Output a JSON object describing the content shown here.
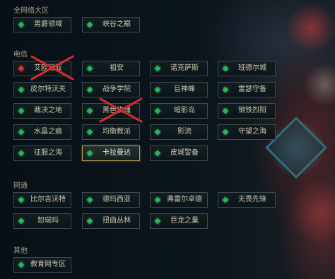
{
  "sections": {
    "all_network": {
      "label": "全网络大区",
      "servers": [
        {
          "name": "男爵领域",
          "status": "green",
          "selected": false
        },
        {
          "name": "峡谷之巅",
          "status": "green",
          "selected": false
        }
      ]
    },
    "telecom": {
      "label": "电信",
      "servers": [
        {
          "name": "艾欧尼亚",
          "status": "red",
          "selected": false
        },
        {
          "name": "祖安",
          "status": "green",
          "selected": false
        },
        {
          "name": "诺克萨斯",
          "status": "green",
          "selected": false
        },
        {
          "name": "班德尔城",
          "status": "green",
          "selected": false
        },
        {
          "name": "皮尔特沃夫",
          "status": "green",
          "selected": false
        },
        {
          "name": "战争学院",
          "status": "green",
          "selected": false
        },
        {
          "name": "巨神峰",
          "status": "green",
          "selected": false
        },
        {
          "name": "雷瑟守备",
          "status": "green",
          "selected": false
        },
        {
          "name": "裁决之地",
          "status": "green",
          "selected": false
        },
        {
          "name": "黑色玫瑰",
          "status": "green",
          "selected": false
        },
        {
          "name": "暗影岛",
          "status": "green",
          "selected": false
        },
        {
          "name": "钢铁烈阳",
          "status": "green",
          "selected": false
        },
        {
          "name": "水晶之痕",
          "status": "green",
          "selected": false
        },
        {
          "name": "均衡教派",
          "status": "green",
          "selected": false
        },
        {
          "name": "影流",
          "status": "green",
          "selected": false
        },
        {
          "name": "守望之海",
          "status": "green",
          "selected": false
        },
        {
          "name": "征服之海",
          "status": "green",
          "selected": false
        },
        {
          "name": "卡拉曼达",
          "status": "green",
          "selected": true
        },
        {
          "name": "皮城警备",
          "status": "green",
          "selected": false
        }
      ]
    },
    "netcom": {
      "label": "网通",
      "servers": [
        {
          "name": "比尔吉沃特",
          "status": "green",
          "selected": false
        },
        {
          "name": "德玛西亚",
          "status": "green",
          "selected": false
        },
        {
          "name": "弗雷尔卓德",
          "status": "green",
          "selected": false
        },
        {
          "name": "无畏先锋",
          "status": "green",
          "selected": false
        },
        {
          "name": "恕瑞玛",
          "status": "green",
          "selected": false
        },
        {
          "name": "扭曲丛林",
          "status": "green",
          "selected": false
        },
        {
          "name": "巨龙之巢",
          "status": "green",
          "selected": false
        }
      ]
    },
    "other": {
      "label": "其他",
      "servers": [
        {
          "name": "教育网专区",
          "status": "green",
          "selected": false
        }
      ]
    }
  },
  "annotations": {
    "cross_mark_color": "#d42a2a",
    "crossed_servers": [
      "艾欧尼亚",
      "黑色玫瑰"
    ]
  },
  "colors": {
    "online_indicator": "#2bb55a",
    "offline_indicator": "#e03030",
    "selected_border": "#b89b5e",
    "label_text": "#cdc5ad"
  }
}
